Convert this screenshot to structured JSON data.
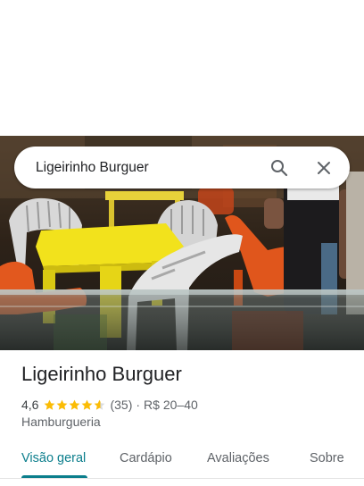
{
  "search": {
    "query": "Ligeirinho Burguer",
    "search_icon": "search-icon",
    "close_icon": "close-icon"
  },
  "hero": {
    "description_icon": "place-photo"
  },
  "place": {
    "name": "Ligeirinho Burguer",
    "rating": "4,6",
    "stars": 4.6,
    "review_count": "(35)",
    "separator": "·",
    "price_range": "R$ 20–40",
    "category": "Hamburgueria"
  },
  "tabs": [
    {
      "label": "Visão geral",
      "active": true
    },
    {
      "label": "Cardápio",
      "active": false
    },
    {
      "label": "Avaliações",
      "active": false
    },
    {
      "label": "Sobre",
      "active": false
    }
  ],
  "colors": {
    "accent": "#0b7e8c",
    "star": "#fbbc04",
    "text_primary": "#202124",
    "text_secondary": "#5f6368"
  }
}
